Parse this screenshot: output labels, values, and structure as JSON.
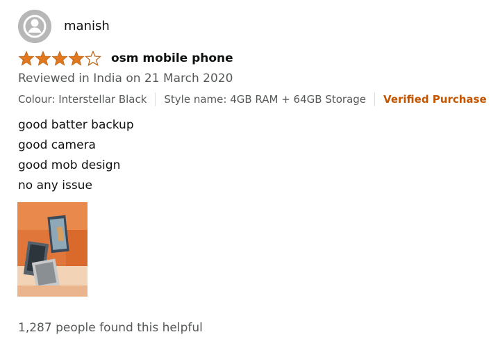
{
  "reviewer": {
    "name": "manish",
    "avatar_icon": "user-silhouette-icon"
  },
  "rating": {
    "stars_filled": 4,
    "stars_total": 5,
    "star_color": "#de7921"
  },
  "review": {
    "title": "osm mobile phone",
    "date_text": "Reviewed in India on 21 March 2020",
    "colour": "Colour: Interstellar Black",
    "style": "Style name: 4GB RAM + 64GB Storage",
    "verified": "Verified Purchase",
    "body_lines": [
      "good batter backup",
      "good camera",
      "good mob design",
      "no any issue"
    ]
  },
  "footer": {
    "helpful_text": "1,287 people found this helpful"
  },
  "colors": {
    "verified": "#c45500",
    "secondary_text": "#565959",
    "primary_text": "#0f1111"
  }
}
